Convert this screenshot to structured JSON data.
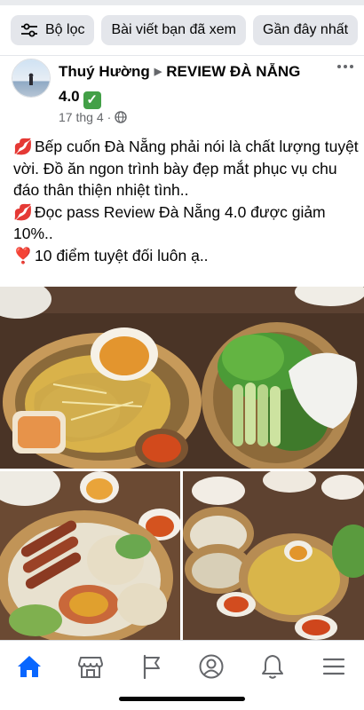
{
  "filters": [
    {
      "label": "Bộ lọc",
      "icon": "sliders-icon"
    },
    {
      "label": "Bài viết bạn đã xem"
    },
    {
      "label": "Gần đây nhất"
    }
  ],
  "post": {
    "author": "Thuý Hường",
    "group": "REVIEW ĐÀ NẴNG 4.0",
    "verified_emoji": "✅",
    "date": "17 thg 4",
    "separator": "·",
    "privacy_icon": "globe-icon",
    "lines": [
      {
        "emoji": "💋",
        "text": "Bếp cuốn Đà Nẵng phải nói là chất lượng tuyệt vời. Đồ ăn ngon trình bày đẹp mắt phục vụ chu đáo thân thiện nhiệt tình.."
      },
      {
        "emoji": "💋",
        "text": "Đọc pass Review Đà Nẵng 4.0 được giảm 10%.."
      },
      {
        "emoji": "❣️",
        "text": "10 điểm tuyệt đối luôn ạ.."
      }
    ]
  },
  "tabs": [
    {
      "name": "home-icon",
      "active": true
    },
    {
      "name": "marketplace-icon",
      "active": false
    },
    {
      "name": "pages-flag-icon",
      "active": false
    },
    {
      "name": "profile-icon",
      "active": false
    },
    {
      "name": "notifications-bell-icon",
      "active": false
    },
    {
      "name": "menu-icon",
      "active": false
    }
  ],
  "colors": {
    "accent": "#0866ff",
    "muted": "#65676b",
    "chip_bg": "#e4e6eb"
  }
}
